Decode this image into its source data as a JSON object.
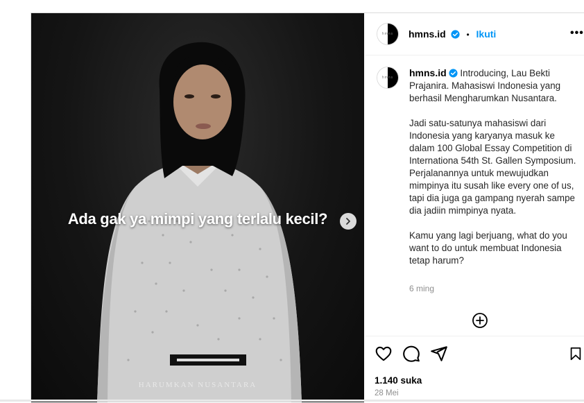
{
  "post": {
    "overlay_text": "Ada gak ya  mimpi yang terlalu kecil?",
    "brand_watermark": "HARUMKAN NUSANTARA",
    "icons": {
      "next": "chevron-right-icon",
      "verified": "verified-badge-icon"
    }
  },
  "header": {
    "username": "hmns.id",
    "avatar_text": "hmns",
    "separator": "•",
    "follow_label": "Ikuti",
    "more_label": "•••"
  },
  "caption": {
    "username": "hmns.id",
    "paragraphs": [
      "Introducing, Lau Bekti Prajanira. Mahasiswi Indonesia yang berhasil Mengharumkan Nusantara.",
      "Jadi satu-satunya mahasiswi dari Indonesia yang karyanya masuk ke dalam 100 Global Essay Competition di Internationa 54th St. Gallen Symposium. Perjalanannya untuk mewujudkan mimpinya itu susah like every one of us, tapi dia juga ga gampang nyerah sampe dia jadiin mimpinya nyata.",
      "Kamu yang lagi berjuang, what do you want to do untuk membuat Indonesia tetap harum?"
    ],
    "time": "6 ming"
  },
  "actions": {
    "likes": "1.140 suka",
    "date": "28 Mei"
  },
  "colors": {
    "accent": "#0095f6",
    "secondary_text": "#8e8e8e"
  }
}
